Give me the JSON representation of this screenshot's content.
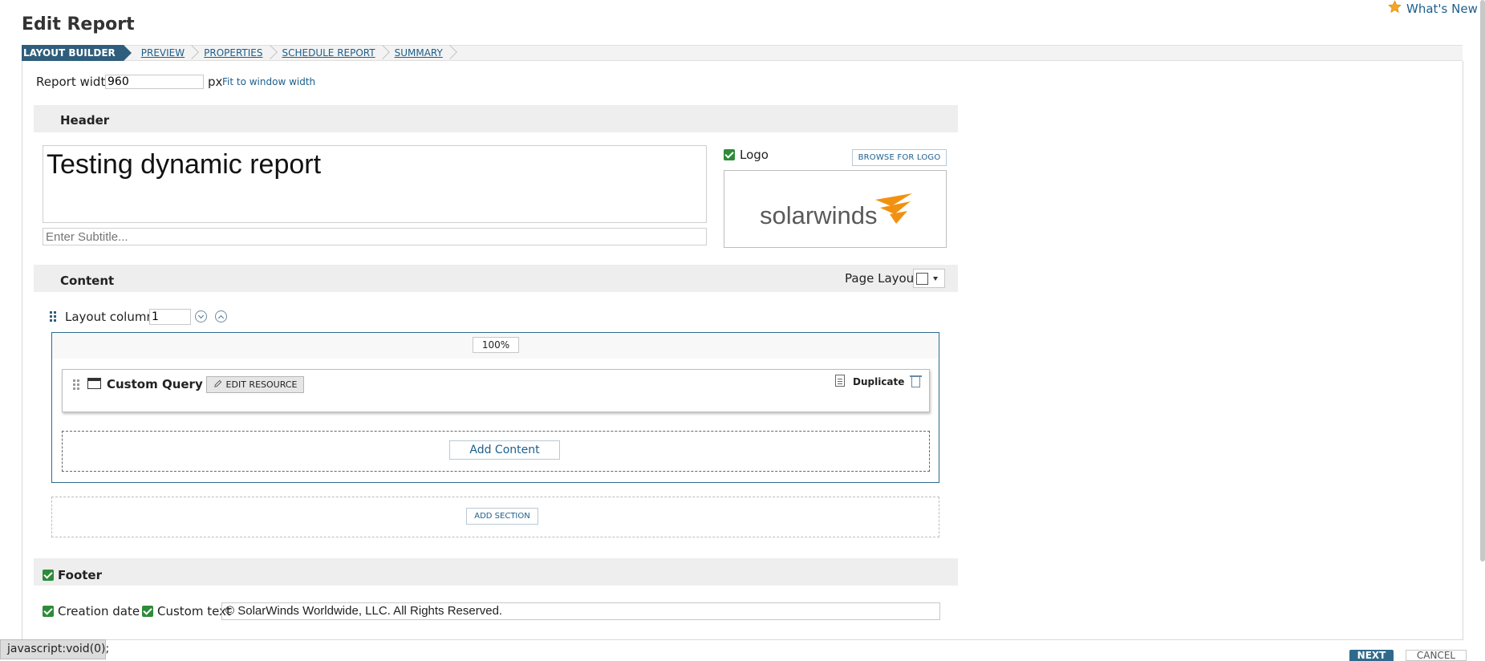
{
  "page": {
    "title": "Edit Report",
    "whats_new": "What's New"
  },
  "wizard": {
    "steps": [
      {
        "label": "LAYOUT BUILDER"
      },
      {
        "label": "PREVIEW"
      },
      {
        "label": "PROPERTIES"
      },
      {
        "label": "SCHEDULE REPORT"
      },
      {
        "label": "SUMMARY"
      }
    ]
  },
  "report_width": {
    "label": "Report width",
    "value": "960",
    "unit": "px",
    "fit_link": "Fit to window width"
  },
  "header": {
    "section_title": "Header",
    "title_value": "Testing dynamic report",
    "subtitle_placeholder": "Enter Subtitle...",
    "logo_label": "Logo",
    "browse_button": "BROWSE FOR LOGO",
    "logo_text": "solarwinds"
  },
  "content": {
    "section_title": "Content",
    "page_layout_label": "Page Layout",
    "layout_columns_label": "Layout columns",
    "layout_columns_value": "1",
    "column_width": "100%",
    "resource": {
      "title": "Custom Query",
      "edit_button": "EDIT RESOURCE",
      "duplicate_label": "Duplicate"
    },
    "add_content_button": "Add Content",
    "add_section_button": "ADD SECTION"
  },
  "footer": {
    "section_title": "Footer",
    "creation_date_label": "Creation date",
    "custom_text_label": "Custom text",
    "custom_text_value": "© SolarWinds Worldwide, LLC. All Rights Reserved."
  },
  "status_bar": {
    "text": "javascript:void(0);"
  },
  "actions": {
    "next": "NEXT",
    "cancel": "CANCEL"
  },
  "colors": {
    "accent": "#2f5e7c",
    "link": "#1c5f8c",
    "check": "#2e8b3a",
    "logo_orange": "#f29111"
  }
}
